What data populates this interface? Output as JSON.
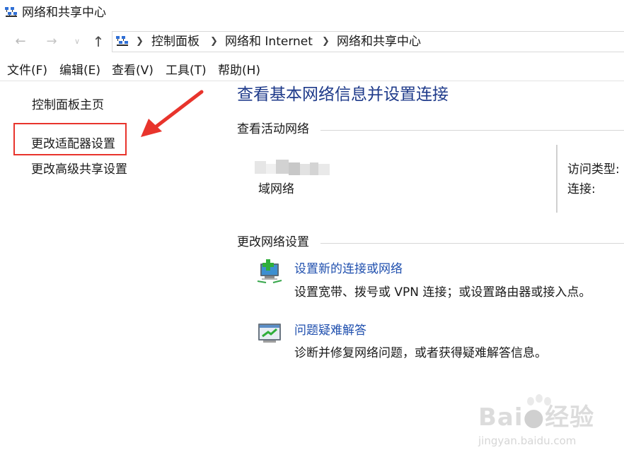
{
  "window": {
    "title": "网络和共享中心"
  },
  "address_bar": {
    "crumbs": [
      "控制面板",
      "网络和 Internet",
      "网络和共享中心"
    ],
    "separator": ">"
  },
  "menu": [
    "文件(F)",
    "编辑(E)",
    "查看(V)",
    "工具(T)",
    "帮助(H)"
  ],
  "left_pane": {
    "items": [
      "控制面板主页",
      "更改适配器设置",
      "更改高级共享设置"
    ]
  },
  "main": {
    "heading": "查看基本网络信息并设置连接",
    "active_networks": {
      "label": "查看活动网络",
      "network_type": "域网络",
      "access_type_label": "访问类型:",
      "connections_label": "连接:"
    },
    "change_settings": {
      "label": "更改网络设置",
      "tasks": [
        {
          "link": "设置新的连接或网络",
          "description": "设置宽带、拨号或 VPN 连接；或设置路由器或接入点。",
          "icon": "new-connection-icon"
        },
        {
          "link": "问题疑难解答",
          "description": "诊断并修复网络问题，或者获得疑难解答信息。",
          "icon": "troubleshoot-icon"
        }
      ]
    }
  },
  "annotation": {
    "color": "#e8342c"
  },
  "colors": {
    "heading": "#1e3a8a",
    "link": "#1f4fae"
  },
  "watermark": {
    "url": "jingyan.baidu.com"
  }
}
